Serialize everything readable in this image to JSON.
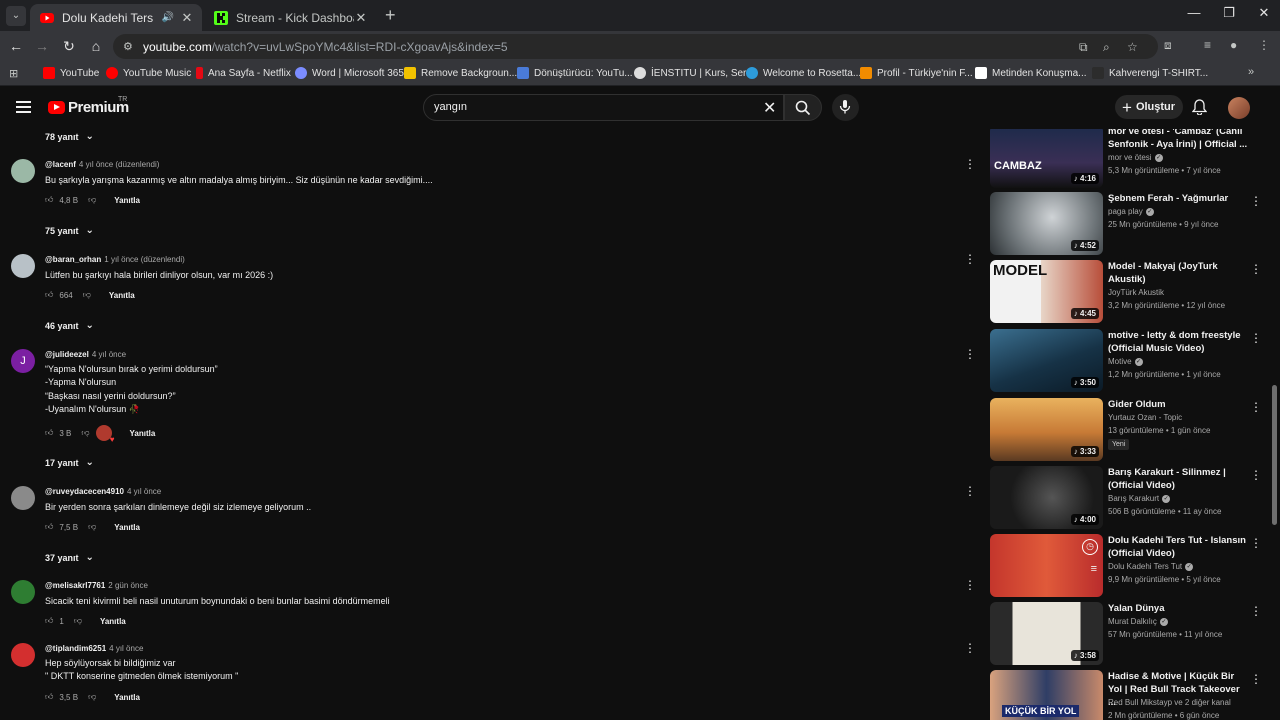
{
  "browser": {
    "tabs": [
      {
        "title": "Dolu Kadehi Ters Tut - Yapm",
        "active": true
      },
      {
        "title": "Stream - Kick Dashboard",
        "active": false
      }
    ],
    "url": {
      "host": "youtube.com",
      "path": "/watch?v=uvLwSpoYMc4&list=RDI-cXgoavAjs&index=5"
    },
    "bookmarks": [
      "YouTube",
      "YouTube Music",
      "Ana Sayfa - Netflix",
      "Word | Microsoft 365",
      "Remove Backgroun...",
      "Dönüştürücü: YouTu...",
      "İENSTITU | Kurs, Ser...",
      "Welcome to Rosetta...",
      "Profil - Türkiye'nin F...",
      "Metinden Konuşma...",
      "Kahverengi T-SHIRT..."
    ]
  },
  "header": {
    "logo": "Premium",
    "logo_region": "TR",
    "search_value": "yangın",
    "create_label": "Oluştur"
  },
  "colors": {
    "brand": "#ff0000",
    "background": "#0f0f0f",
    "secondary_text": "#aaaaaa"
  },
  "comments": [
    {
      "type": "replies",
      "label": "78 yanıt"
    },
    {
      "type": "comment",
      "handle": "@lacenf",
      "time": "4 yıl önce (düzenlendi)",
      "lines": [
        "Bu şarkıyla yarışma kazanmış ve altın madalya almış biriyim... Siz düşünün ne kadar sevdiğimi...."
      ],
      "likes": "4,8 B",
      "reply": "Yanıtla"
    },
    {
      "type": "replies",
      "label": "75 yanıt"
    },
    {
      "type": "comment",
      "handle": "@baran_orhan",
      "time": "1 yıl önce (düzenlendi)",
      "lines": [
        "Lütfen bu şarkıyı hala birileri dinliyor olsun, var mı 2026 :)"
      ],
      "likes": "664",
      "reply": "Yanıtla"
    },
    {
      "type": "replies",
      "label": "46 yanıt"
    },
    {
      "type": "comment",
      "handle": "@julideezel",
      "time": "4 yıl önce",
      "lines": [
        "“Yapma N'olursun bırak o yerimi doldursun”",
        "-Yapma N'olursun",
        "“Başkası nasıl yerini doldursun?”",
        "-Uyanalım N'olursun 🥀"
      ],
      "likes": "3 B",
      "reply": "Yanıtla",
      "avatar_letter": "J"
    },
    {
      "type": "replies",
      "label": "17 yanıt"
    },
    {
      "type": "comment",
      "handle": "@ruveydacecen4910",
      "time": "4 yıl önce",
      "lines": [
        "Bir yerden sonra şarkıları dinlemeye değil siz izlemeye geliyorum .."
      ],
      "likes": "7,5 B",
      "reply": "Yanıtla"
    },
    {
      "type": "replies",
      "label": "37 yanıt"
    },
    {
      "type": "comment",
      "handle": "@melisakrl7761",
      "time": "2 gün önce",
      "lines": [
        "Sicacik teni kivirmli beli nasil unuturum  boynundaki o beni bunlar basimi döndürmemeli"
      ],
      "likes": "1",
      "reply": "Yanıtla"
    },
    {
      "type": "comment",
      "handle": "@tiplandim6251",
      "time": "4 yıl önce",
      "lines": [
        "Hep söylüyorsak bi bildiğimiz var",
        "\" DKTT konserine gitmeden ölmek istemiyorum \""
      ],
      "likes": "3,5 B",
      "reply": "Yanıtla"
    }
  ],
  "sidebar": [
    {
      "title": "mor ve ötesi - 'Cambaz' (Canlı Senfonik - Aya İrini) | Official ...",
      "channel": "mor ve ötesi",
      "stats": "5,3 Mn görüntüleme • 7 yıl önce",
      "duration": "4:16",
      "thumb_text": "CAMBAZ"
    },
    {
      "title": "Şebnem Ferah - Yağmurlar",
      "channel": "paga play",
      "stats": "25 Mn görüntüleme • 9 yıl önce",
      "duration": "4:52"
    },
    {
      "title": "Model - Makyaj (JoyTurk Akustik)",
      "channel": "JoyTürk Akustik",
      "stats": "3,2 Mn görüntüleme • 12 yıl önce",
      "duration": "4:45",
      "thumb_text": "MODEL"
    },
    {
      "title": "motive - letty & dom freestyle (Official Music Video)",
      "channel": "Motive",
      "stats": "1,2 Mn görüntüleme • 1 yıl önce",
      "duration": "3:50"
    },
    {
      "title": "Gider Oldum",
      "channel": "Yurtauz Ozan - Topic",
      "stats": "13 görüntüleme • 1 gün önce",
      "duration": "3:33",
      "badge": "Yeni"
    },
    {
      "title": "Barış Karakurt - Silinmez | (Official Video)",
      "channel": "Barış Karakurt",
      "stats": "506 B görüntüleme • 11 ay önce",
      "duration": "4:00"
    },
    {
      "title": "Dolu Kadehi Ters Tut - Islansın (Official Video)",
      "channel": "Dolu Kadehi Ters Tut",
      "stats": "9,9 Mn görüntüleme • 5 yıl önce"
    },
    {
      "title": "Yalan Dünya",
      "channel": "Murat Dalkılıç",
      "stats": "57 Mn görüntüleme • 11 yıl önce",
      "duration": "3:58"
    },
    {
      "title": "Hadise & Motive | Küçük Bir Yol | Red Bull Track Takeover ...",
      "channel": "Red Bull Mikstayp ve 2 diğer kanal",
      "stats": "2 Mn görüntüleme • 6 gün önce",
      "thumb_text": "KÜÇÜK BİR YOL"
    }
  ]
}
